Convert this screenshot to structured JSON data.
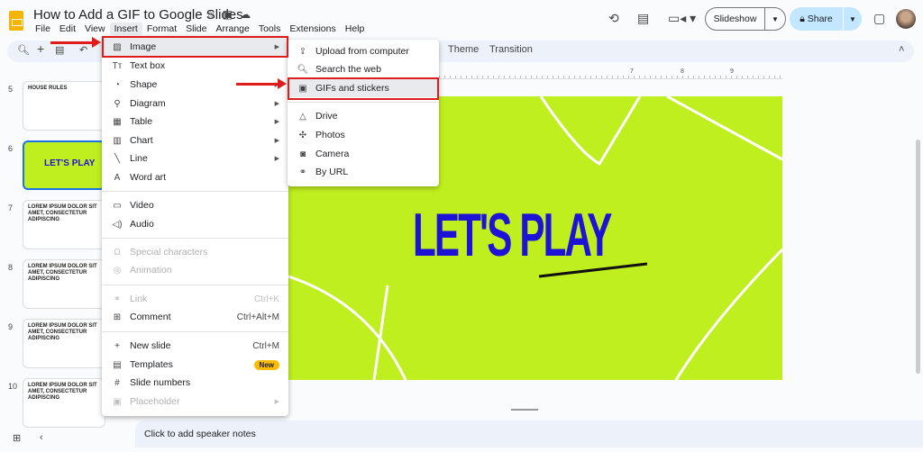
{
  "doc": {
    "title": "How to Add a GIF to Google Slides"
  },
  "menubar": [
    "File",
    "Edit",
    "View",
    "Insert",
    "Format",
    "Slide",
    "Arrange",
    "Tools",
    "Extensions",
    "Help"
  ],
  "header": {
    "slideshow": "Slideshow",
    "share": "Share"
  },
  "toolbar": {
    "theme": "Theme",
    "transition": "Transition"
  },
  "ruler": [
    "7",
    "8",
    "9"
  ],
  "filmstrip": [
    {
      "num": "5",
      "title": "HOUSE RULES"
    },
    {
      "num": "6",
      "title": "LET'S PLAY"
    },
    {
      "num": "7",
      "title": "LOREM IPSUM DOLOR SIT AMET, CONSECTETUR ADIPISCING"
    },
    {
      "num": "8",
      "title": "LOREM IPSUM DOLOR SIT AMET, CONSECTETUR ADIPISCING"
    },
    {
      "num": "9",
      "title": "LOREM IPSUM DOLOR SIT AMET, CONSECTETUR ADIPISCING"
    },
    {
      "num": "10",
      "title": "LOREM IPSUM DOLOR SIT AMET, CONSECTETUR ADIPISCING"
    }
  ],
  "slide": {
    "text": "LET'S PLAY",
    "bg": "#c0ef1f",
    "text_color": "#1d12d6"
  },
  "notes": {
    "placeholder": "Click to add speaker notes"
  },
  "insert_menu": [
    {
      "label": "Image",
      "icon": "image-icon",
      "submenu": true
    },
    {
      "label": "Text box",
      "icon": "text-box-icon"
    },
    {
      "label": "Shape",
      "icon": "shape-icon",
      "submenu": true
    },
    {
      "label": "Diagram",
      "icon": "diagram-icon",
      "submenu": true
    },
    {
      "label": "Table",
      "icon": "table-icon",
      "submenu": true
    },
    {
      "label": "Chart",
      "icon": "chart-icon",
      "submenu": true
    },
    {
      "label": "Line",
      "icon": "line-icon",
      "submenu": true
    },
    {
      "label": "Word art",
      "icon": "word-art-icon"
    },
    {
      "label": "Video",
      "icon": "video-icon"
    },
    {
      "label": "Audio",
      "icon": "audio-icon"
    },
    {
      "label": "Special characters",
      "icon": "omega-icon",
      "disabled": true
    },
    {
      "label": "Animation",
      "icon": "animation-icon",
      "disabled": true
    },
    {
      "label": "Link",
      "icon": "link-icon",
      "shortcut": "Ctrl+K",
      "disabled": true
    },
    {
      "label": "Comment",
      "icon": "comment-icon",
      "shortcut": "Ctrl+Alt+M"
    },
    {
      "label": "New slide",
      "icon": "plus-icon",
      "shortcut": "Ctrl+M"
    },
    {
      "label": "Templates",
      "icon": "templates-icon",
      "badge": "New"
    },
    {
      "label": "Slide numbers",
      "icon": "hash-icon"
    },
    {
      "label": "Placeholder",
      "icon": "placeholder-icon",
      "submenu": true,
      "disabled": true
    }
  ],
  "image_submenu": [
    {
      "label": "Upload from computer",
      "icon": "upload-icon"
    },
    {
      "label": "Search the web",
      "icon": "search-icon"
    },
    {
      "label": "GIFs and stickers",
      "icon": "gif-icon"
    },
    {
      "label": "Drive",
      "icon": "drive-icon"
    },
    {
      "label": "Photos",
      "icon": "photos-icon"
    },
    {
      "label": "Camera",
      "icon": "camera-icon"
    },
    {
      "label": "By URL",
      "icon": "link-icon"
    }
  ],
  "annotation_color": "#e01b1b"
}
